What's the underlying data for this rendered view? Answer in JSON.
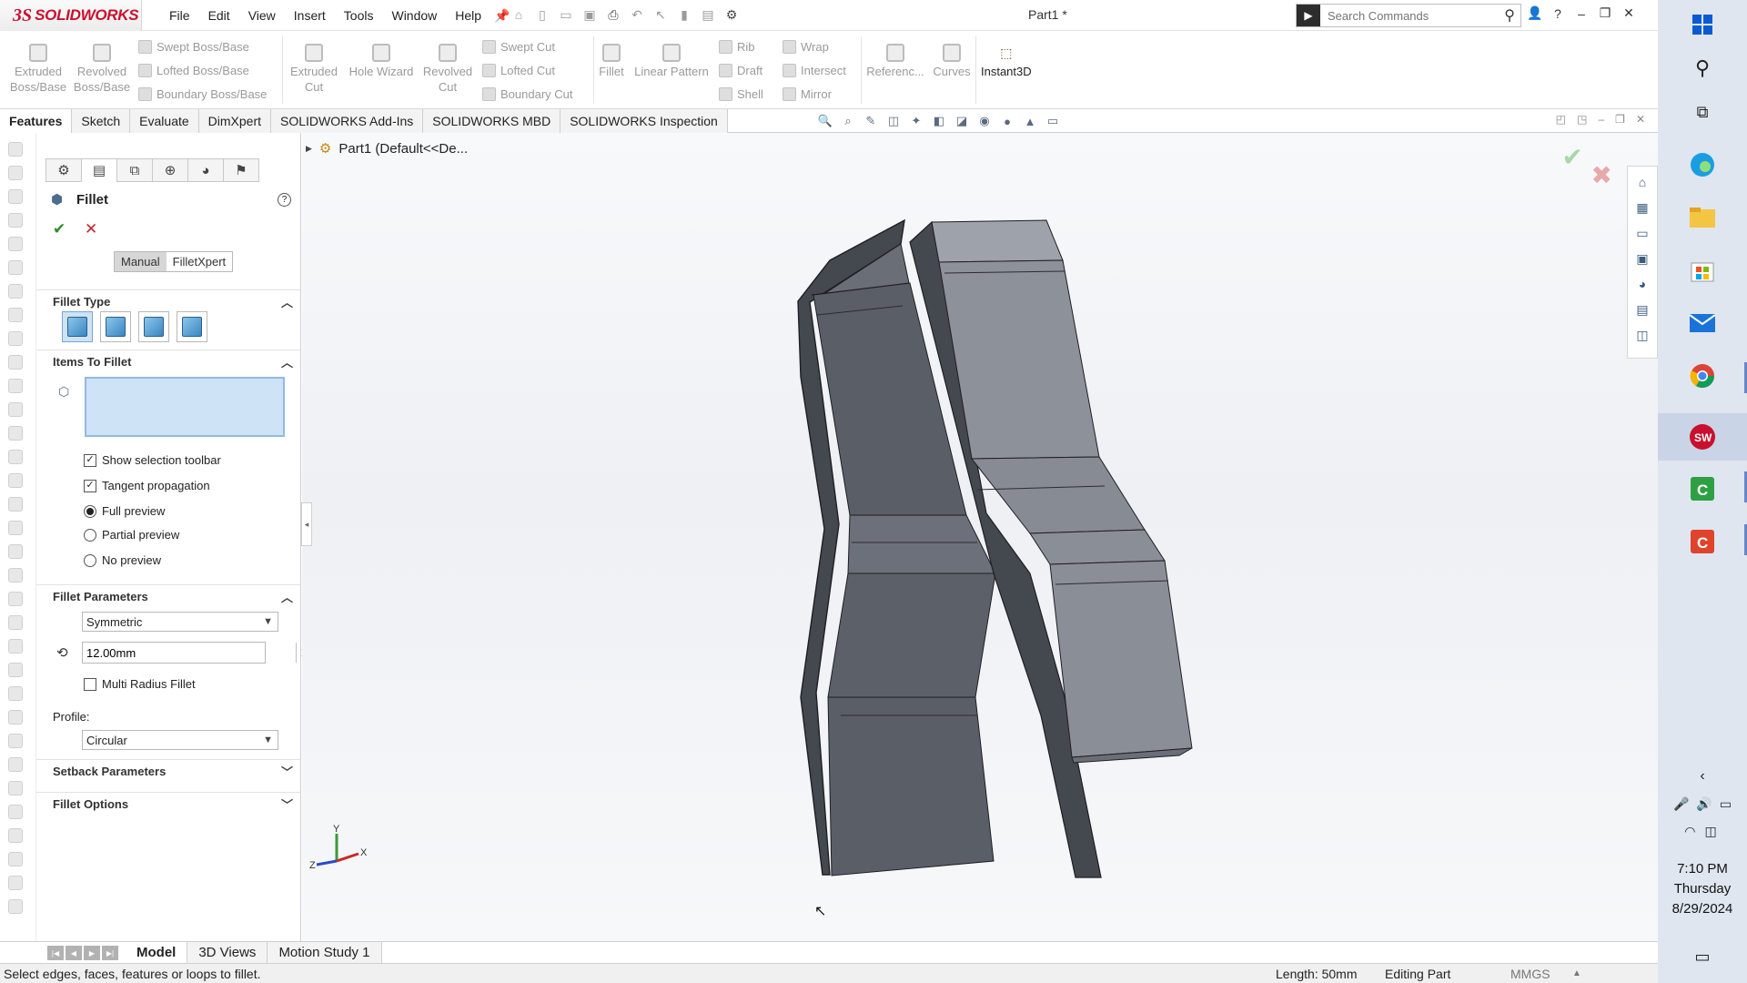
{
  "app": {
    "brand": "SOLIDWORKS",
    "document_title": "Part1 *",
    "menu": [
      "File",
      "Edit",
      "View",
      "Insert",
      "Tools",
      "Window",
      "Help"
    ],
    "search": {
      "placeholder": "Search Commands"
    }
  },
  "command_manager": {
    "big_buttons": [
      {
        "label_line1": "Extruded",
        "label_line2": "Boss/Base"
      },
      {
        "label_line1": "Revolved",
        "label_line2": "Boss/Base"
      },
      {
        "label_line1": "Extruded",
        "label_line2": "Cut"
      },
      {
        "label_line1": "Hole Wizard",
        "label_line2": ""
      },
      {
        "label_line1": "Revolved",
        "label_line2": "Cut"
      },
      {
        "label_line1": "Fillet",
        "label_line2": ""
      },
      {
        "label_line1": "Linear Pattern",
        "label_line2": ""
      },
      {
        "label_line1": "Referenc...",
        "label_line2": ""
      },
      {
        "label_line1": "Curves",
        "label_line2": ""
      }
    ],
    "small_buttons": {
      "swept_boss": "Swept Boss/Base",
      "lofted_boss": "Lofted Boss/Base",
      "boundary_boss": "Boundary Boss/Base",
      "swept_cut": "Swept Cut",
      "lofted_cut": "Lofted Cut",
      "boundary_cut": "Boundary Cut",
      "rib": "Rib",
      "draft": "Draft",
      "shell": "Shell",
      "wrap": "Wrap",
      "intersect": "Intersect",
      "mirror": "Mirror"
    },
    "instant3d": "Instant3D"
  },
  "tabs": [
    "Features",
    "Sketch",
    "Evaluate",
    "DimXpert",
    "SOLIDWORKS Add-Ins",
    "SOLIDWORKS MBD",
    "SOLIDWORKS Inspection"
  ],
  "property_manager": {
    "title": "Fillet",
    "modes": [
      "Manual",
      "FilletXpert"
    ],
    "sections": {
      "fillet_type": "Fillet Type",
      "items_to_fillet": "Items To Fillet",
      "fillet_parameters": "Fillet Parameters",
      "setback_parameters": "Setback Parameters",
      "fillet_options": "Fillet Options"
    },
    "options": {
      "show_selection_toolbar": "Show selection toolbar",
      "tangent_propagation": "Tangent propagation",
      "full_preview": "Full preview",
      "partial_preview": "Partial preview",
      "no_preview": "No preview"
    },
    "parameters": {
      "method": "Symmetric",
      "radius": "12.00mm",
      "multi_radius": "Multi Radius Fillet",
      "profile_label": "Profile:",
      "profile": "Circular"
    }
  },
  "graphics": {
    "tree_label": "Part1  (Default<<De...",
    "triad": {
      "x": "X",
      "y": "Y",
      "z": "Z"
    }
  },
  "model_tabs": [
    "Model",
    "3D Views",
    "Motion Study 1"
  ],
  "status": {
    "message": "Select edges, faces, features or loops to fillet.",
    "length": "Length: 50mm",
    "mode": "Editing Part",
    "units": "MMGS"
  },
  "taskbar": {
    "time": "7:10 PM",
    "day": "Thursday",
    "date": "8/29/2024"
  },
  "colors": {
    "brand_red": "#c8102e",
    "selection_box": "#cfe3f7",
    "model_face_light": "#8a8e97",
    "model_face_dark": "#4f535b"
  }
}
